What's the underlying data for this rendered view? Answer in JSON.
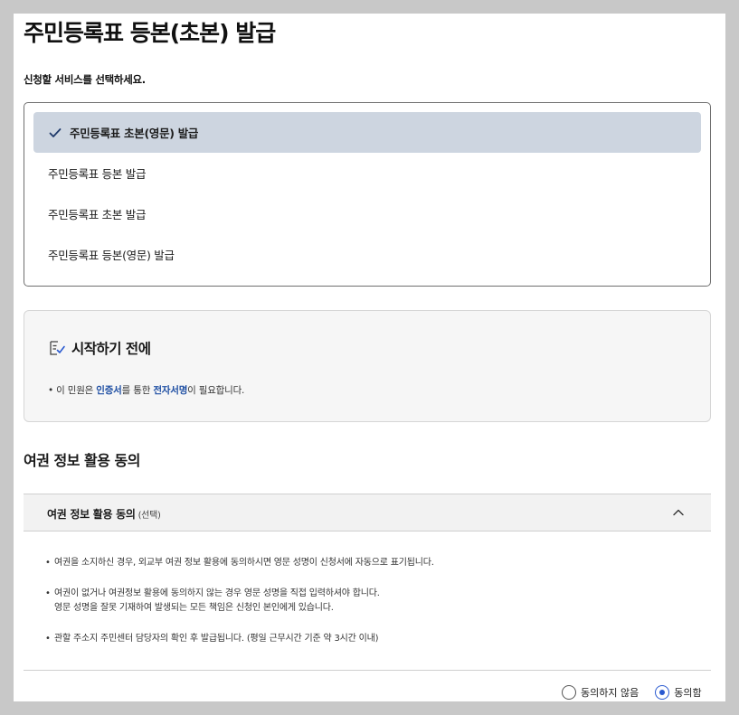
{
  "page": {
    "title": "주민등록표 등본(초본) 발급",
    "select_prompt": "신청할 서비스를 선택하세요."
  },
  "services": {
    "items": [
      {
        "label": "주민등록표 초본(영문) 발급",
        "selected": true
      },
      {
        "label": "주민등록표 등본 발급",
        "selected": false
      },
      {
        "label": "주민등록표 초본 발급",
        "selected": false
      },
      {
        "label": "주민등록표 등본(영문) 발급",
        "selected": false
      }
    ]
  },
  "intro": {
    "title": "시작하기 전에",
    "note_prefix": "이 민원은 ",
    "note_link1": "인증서",
    "note_mid": "를 통한 ",
    "note_link2": "전자서명",
    "note_suffix": "이 필요합니다."
  },
  "consent": {
    "section_title": "여권 정보 활용 동의",
    "accordion_title": "여권 정보 활용 동의",
    "accordion_optional": "(선택)",
    "bullets": [
      "여권을 소지하신 경우, 외교부 여권 정보 활용에 동의하시면 영문 성명이 신청서에 자동으로 표기됩니다.",
      "여권이 없거나 여권정보 활용에 동의하지 않는 경우 영문 성명을 직접 입력하셔야 합니다.",
      "영문 성명을 잘못 기재하여 발생되는 모든 책임은 신청인 본인에게 있습니다.",
      "관할 주소지 주민센터 담당자의 확인 후 발급됩니다. (평일 근무시간 기준 약 3시간 이내)"
    ],
    "radio_disagree": "동의하지 않음",
    "radio_agree": "동의함",
    "selected_option": "agree"
  },
  "colors": {
    "selected_bg": "#cdd5e0",
    "link_blue": "#1f4fa3",
    "radio_blue": "#2a5ad0"
  },
  "icons": {
    "selected_item": "check-icon",
    "intro_heading": "document-check-icon",
    "accordion_toggle": "chevron-up-icon"
  }
}
